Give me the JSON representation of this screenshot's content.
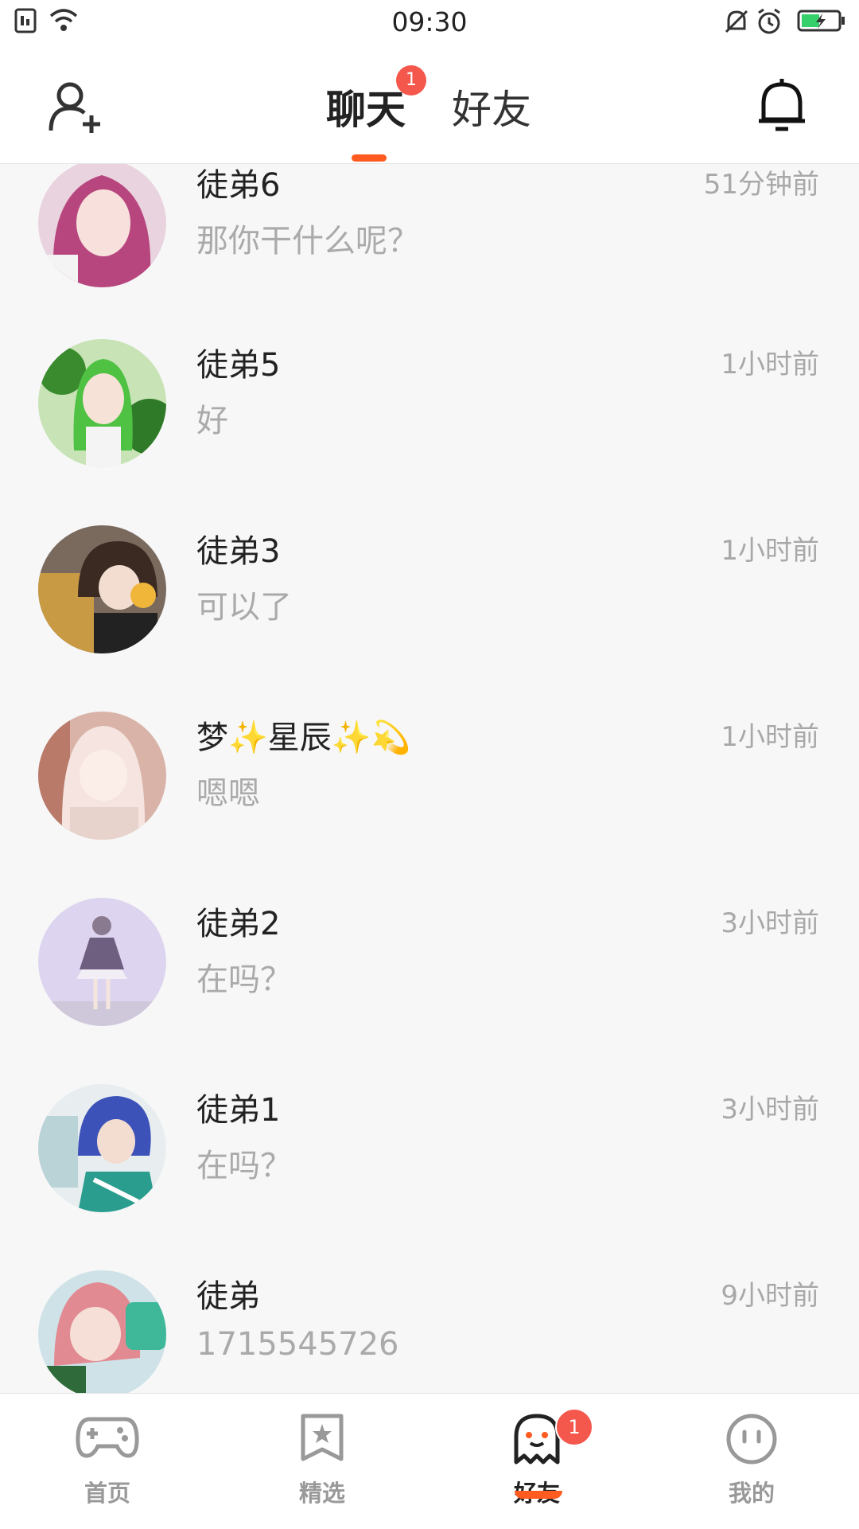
{
  "status_bar": {
    "time": "09:30",
    "battery_color": "#35d06a"
  },
  "header": {
    "tabs": [
      {
        "label": "聊天",
        "active": true,
        "badge": "1"
      },
      {
        "label": "好友",
        "active": false
      }
    ],
    "accent": "#ff5a1f"
  },
  "chats": [
    {
      "name": "徒弟6",
      "time": "51分钟前",
      "preview": "那你干什么呢？",
      "avatar": "pink-hair-girl-avatar"
    },
    {
      "name": " 徒弟5",
      "time": "1小时前",
      "preview": "好",
      "avatar": "green-hair-girl-avatar"
    },
    {
      "name": "徒弟3",
      "time": "1小时前",
      "preview": "可以了",
      "avatar": "brown-hair-boy-avatar"
    },
    {
      "name": "梦✨星辰✨💫",
      "time": "1小时前",
      "preview": "嗯嗯",
      "avatar": "elf-girl-avatar"
    },
    {
      "name": "徒弟2",
      "time": "3小时前",
      "preview": "在吗？",
      "avatar": "maid-girl-avatar"
    },
    {
      "name": "徒弟1",
      "time": "3小时前",
      "preview": "在吗？",
      "avatar": "blue-hair-boy-avatar"
    },
    {
      "name": "徒弟",
      "time": "9小时前",
      "preview": "1715545726",
      "avatar": "pink-hair-kid-avatar"
    }
  ],
  "bottom_nav": [
    {
      "label": "首页",
      "icon": "gamepad-icon",
      "active": false
    },
    {
      "label": "精选",
      "icon": "star-bookmark-icon",
      "active": false
    },
    {
      "label": "好友",
      "icon": "ghost-icon",
      "active": true,
      "badge": "1"
    },
    {
      "label": "我的",
      "icon": "face-icon",
      "active": false
    }
  ]
}
